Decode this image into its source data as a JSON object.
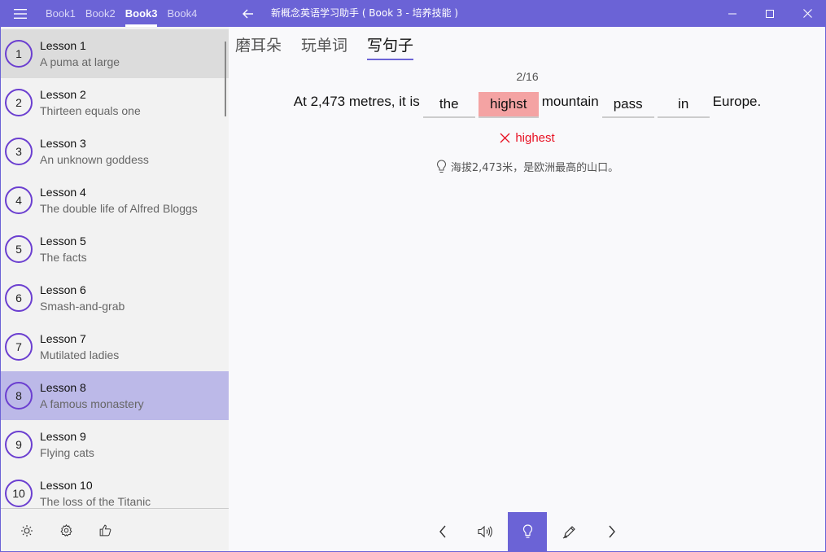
{
  "titlebar": {
    "books": [
      "Book1",
      "Book2",
      "Book3",
      "Book4"
    ],
    "active_book": 2,
    "app_title": "新概念英语学习助手 ( Book 3 - 培养技能 )"
  },
  "sidebar": {
    "lessons": [
      {
        "number": "1",
        "label": "Lesson 1",
        "title": "A puma at large",
        "state": "hover"
      },
      {
        "number": "2",
        "label": "Lesson 2",
        "title": "Thirteen equals one",
        "state": ""
      },
      {
        "number": "3",
        "label": "Lesson 3",
        "title": "An unknown goddess",
        "state": ""
      },
      {
        "number": "4",
        "label": "Lesson 4",
        "title": "The double life of Alfred Bloggs",
        "state": ""
      },
      {
        "number": "5",
        "label": "Lesson 5",
        "title": "The facts",
        "state": ""
      },
      {
        "number": "6",
        "label": "Lesson 6",
        "title": "Smash-and-grab",
        "state": ""
      },
      {
        "number": "7",
        "label": "Lesson 7",
        "title": "Mutilated ladies",
        "state": ""
      },
      {
        "number": "8",
        "label": "Lesson 8",
        "title": "A famous monastery",
        "state": "selected"
      },
      {
        "number": "9",
        "label": "Lesson 9",
        "title": "Flying cats",
        "state": ""
      },
      {
        "number": "10",
        "label": "Lesson 10",
        "title": "The loss of the Titanic",
        "state": ""
      }
    ]
  },
  "main": {
    "tabs": [
      "磨耳朵",
      "玩单词",
      "写句子"
    ],
    "active_tab": 2,
    "progress": "2/16",
    "sentence": [
      {
        "type": "text",
        "value": "At 2,473 metres, it is"
      },
      {
        "type": "blank",
        "value": "the"
      },
      {
        "type": "blank",
        "value": "highst",
        "wrong": true
      },
      {
        "type": "text",
        "value": "mountain"
      },
      {
        "type": "blank",
        "value": "pass"
      },
      {
        "type": "blank",
        "value": "in"
      },
      {
        "type": "text",
        "value": "Europe."
      }
    ],
    "correction": "highest",
    "hint": "海拔2,473米，是欧洲最高的山口。"
  },
  "colors": {
    "accent": "#6b63d6",
    "selected_row": "#bcb9e8",
    "wrong_bg": "#f4a3a3",
    "error_text": "#e81123"
  }
}
